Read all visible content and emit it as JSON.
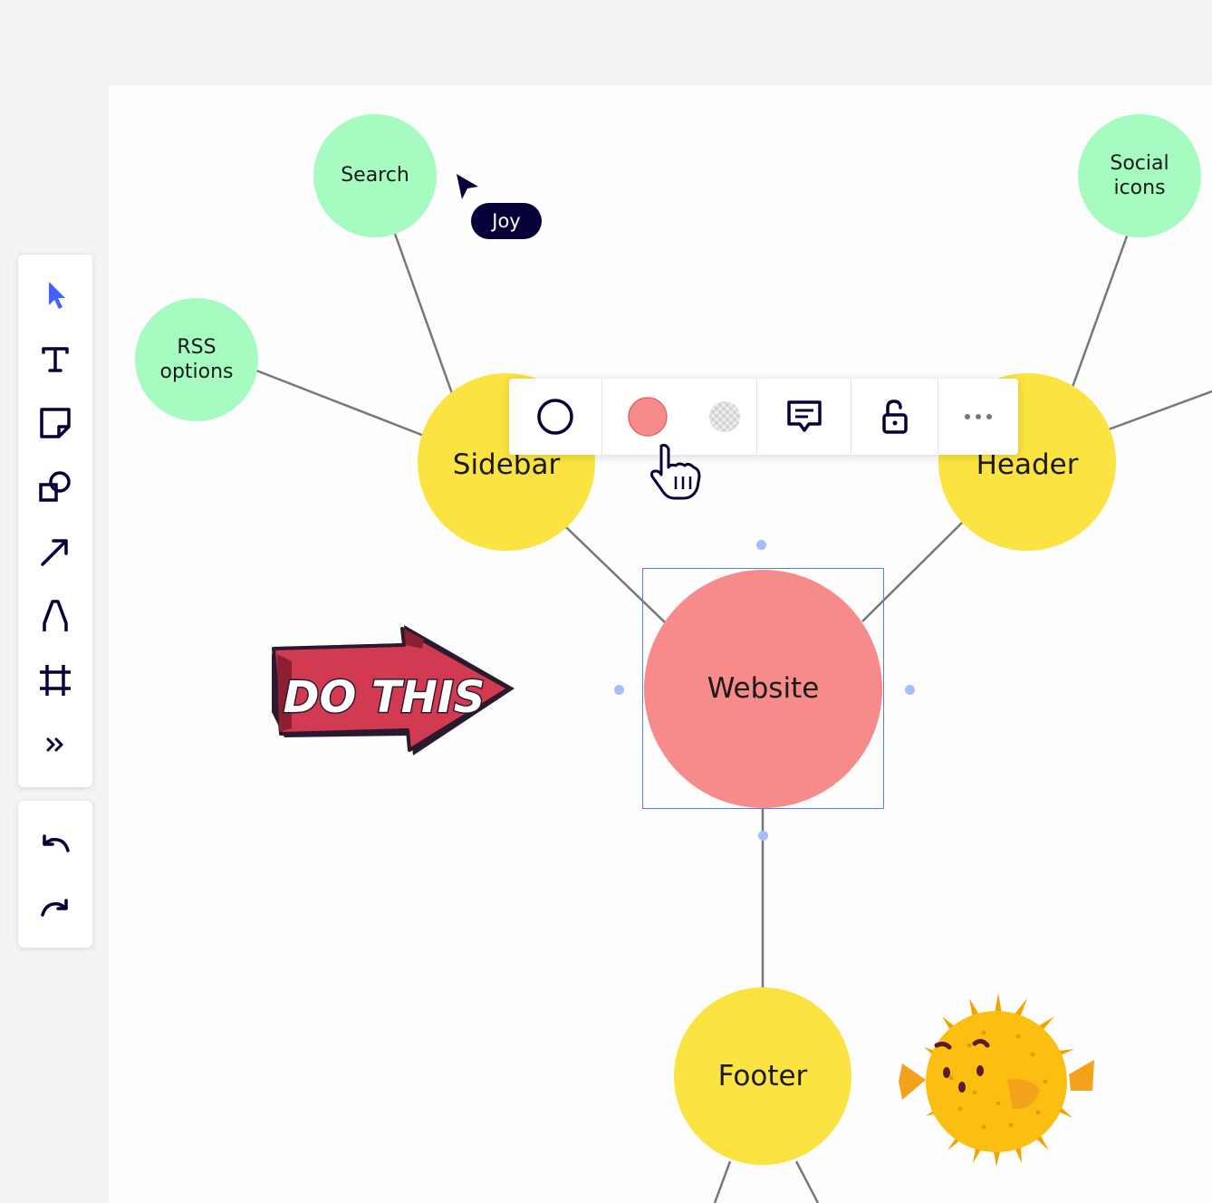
{
  "nodes": {
    "search": "Search",
    "social_icons": "Social\nicons",
    "rss_options": "RSS\noptions",
    "sidebar": "Sidebar",
    "header": "Header",
    "website": "Website",
    "footer": "Footer"
  },
  "sticker": {
    "text": "DO THIS"
  },
  "collaborator": {
    "name": "Joy"
  },
  "colors": {
    "leaf_node": "#a6fbc1",
    "branch_node": "#fbe341",
    "root_node": "#f78a8a",
    "accent": "#4262ff",
    "cursor_label_bg": "#050038"
  },
  "left_toolbar": {
    "tools": [
      "select-icon",
      "text-icon",
      "sticky-note-icon",
      "shapes-icon",
      "arrow-icon",
      "pen-icon",
      "frame-icon",
      "more-tools-icon"
    ],
    "history": [
      "undo-icon",
      "redo-icon"
    ]
  },
  "context_toolbar": {
    "items": [
      "shape-type-circle-icon",
      "fill-color-swatch",
      "border-color-swatch",
      "comment-icon",
      "lock-icon",
      "more-icon"
    ],
    "fill_color": "#f78a8a"
  }
}
